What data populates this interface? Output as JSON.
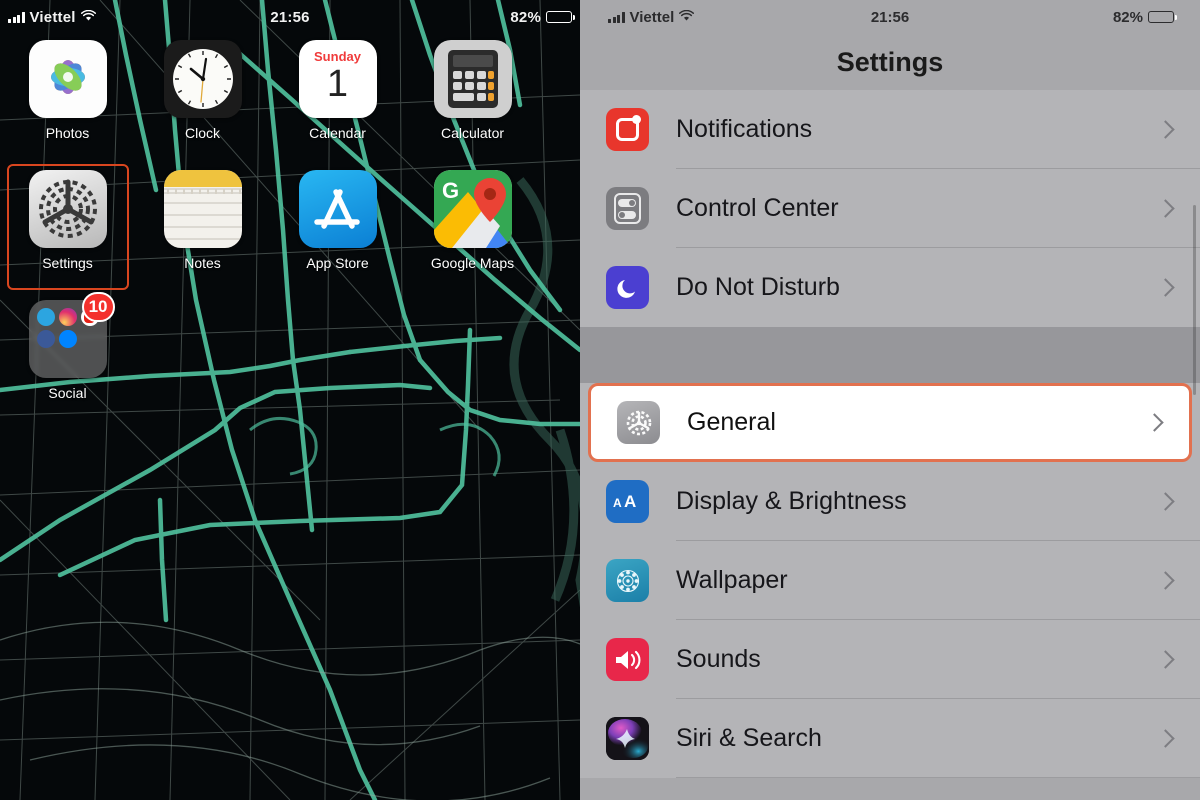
{
  "home_screen": {
    "status_bar": {
      "carrier": "Viettel",
      "time": "21:56",
      "battery_percent": "82%",
      "signal_icon": "cellular-signal-icon",
      "wifi_icon": "wifi-icon",
      "battery_icon": "battery-icon"
    },
    "apps": [
      [
        {
          "label": "Photos",
          "icon": "photos-icon",
          "selected": false
        },
        {
          "label": "Clock",
          "icon": "clock-icon",
          "selected": false
        },
        {
          "label": "Calendar",
          "icon": "calendar-icon",
          "selected": false,
          "weekday": "Sunday",
          "day": "1"
        },
        {
          "label": "Calculator",
          "icon": "calculator-icon",
          "selected": false
        }
      ],
      [
        {
          "label": "Settings",
          "icon": "settings-icon",
          "selected": true
        },
        {
          "label": "Notes",
          "icon": "notes-icon",
          "selected": false
        },
        {
          "label": "App Store",
          "icon": "app-store-icon",
          "selected": false
        },
        {
          "label": "Google Maps",
          "icon": "google-maps-icon",
          "selected": false
        }
      ],
      [
        {
          "label": "Social",
          "icon": "social-folder-icon",
          "selected": false,
          "badge": "10"
        }
      ]
    ],
    "wallpaper": {
      "description": "dark-map-wallpaper",
      "road_color": "#4fbf9c",
      "minor_road_color": "#7d8f8a",
      "background_color": "#05080a"
    }
  },
  "settings_app": {
    "status_bar": {
      "carrier": "Viettel",
      "time": "21:56",
      "battery_percent": "82%"
    },
    "title": "Settings",
    "groups": [
      {
        "rows": [
          {
            "label": "Notifications",
            "icon": "notifications-icon",
            "highlighted": false
          },
          {
            "label": "Control Center",
            "icon": "control-center-icon",
            "highlighted": false
          },
          {
            "label": "Do Not Disturb",
            "icon": "do-not-disturb-icon",
            "highlighted": false
          }
        ]
      },
      {
        "rows": [
          {
            "label": "General",
            "icon": "general-gear-icon",
            "highlighted": true
          },
          {
            "label": "Display & Brightness",
            "icon": "display-brightness-icon",
            "highlighted": false
          },
          {
            "label": "Wallpaper",
            "icon": "wallpaper-icon",
            "highlighted": false
          },
          {
            "label": "Sounds",
            "icon": "sounds-icon",
            "highlighted": false
          },
          {
            "label": "Siri & Search",
            "icon": "siri-search-icon",
            "highlighted": false
          }
        ]
      }
    ]
  },
  "colors": {
    "highlight_border": "#e2714f",
    "home_selection_border": "#d9461f",
    "settings_background": "#a8a8ab",
    "badge_red": "#f4302c"
  }
}
